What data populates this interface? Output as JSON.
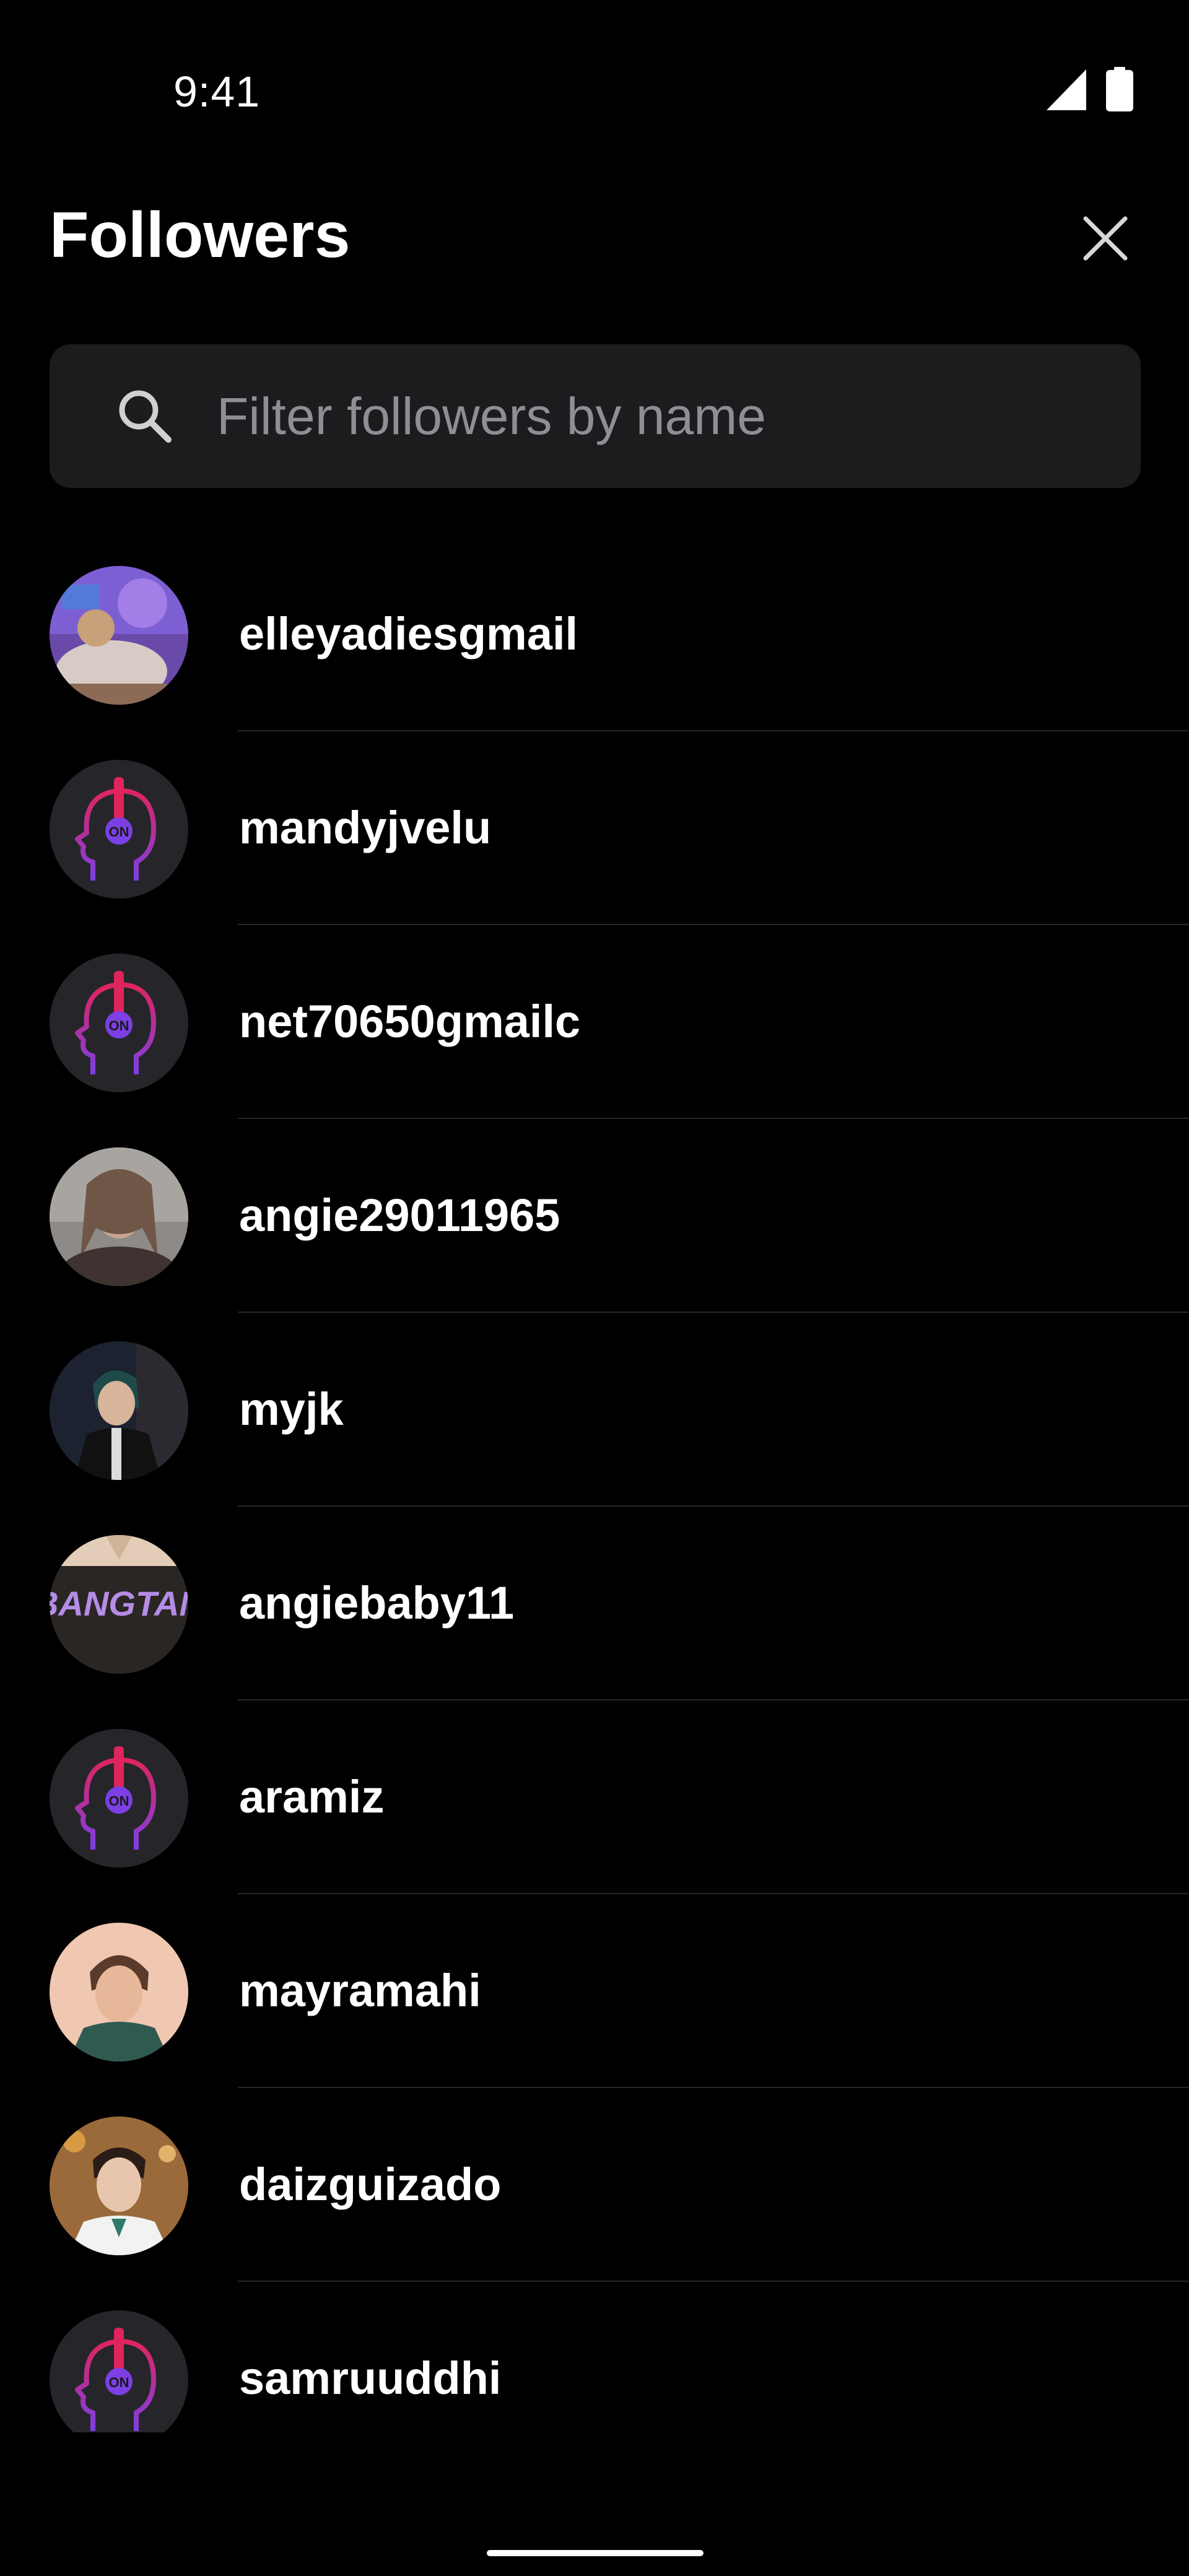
{
  "status_bar": {
    "time": "9:41"
  },
  "header": {
    "title": "Followers",
    "close_icon": "close-icon"
  },
  "search": {
    "placeholder": "Filter followers by name",
    "value": "",
    "icon": "search-icon"
  },
  "followers": [
    {
      "username": "elleyadiesgmail",
      "avatar": "photo"
    },
    {
      "username": "mandyjvelu",
      "avatar": "default-headphones"
    },
    {
      "username": "net70650gmailc",
      "avatar": "default-headphones"
    },
    {
      "username": "angie29011965",
      "avatar": "photo"
    },
    {
      "username": "myjk",
      "avatar": "photo"
    },
    {
      "username": "angiebaby11",
      "avatar": "photo"
    },
    {
      "username": "aramiz",
      "avatar": "default-headphones"
    },
    {
      "username": "mayramahi",
      "avatar": "photo"
    },
    {
      "username": "daizguizado",
      "avatar": "photo"
    },
    {
      "username": "samruuddhi",
      "avatar": "default-headphones"
    }
  ],
  "colors": {
    "background": "#000000",
    "search_background": "#1c1c1e",
    "placeholder": "#8e8e93",
    "divider": "#262626",
    "accent_pink": "#e0245e",
    "accent_purple": "#7b3fe4"
  }
}
